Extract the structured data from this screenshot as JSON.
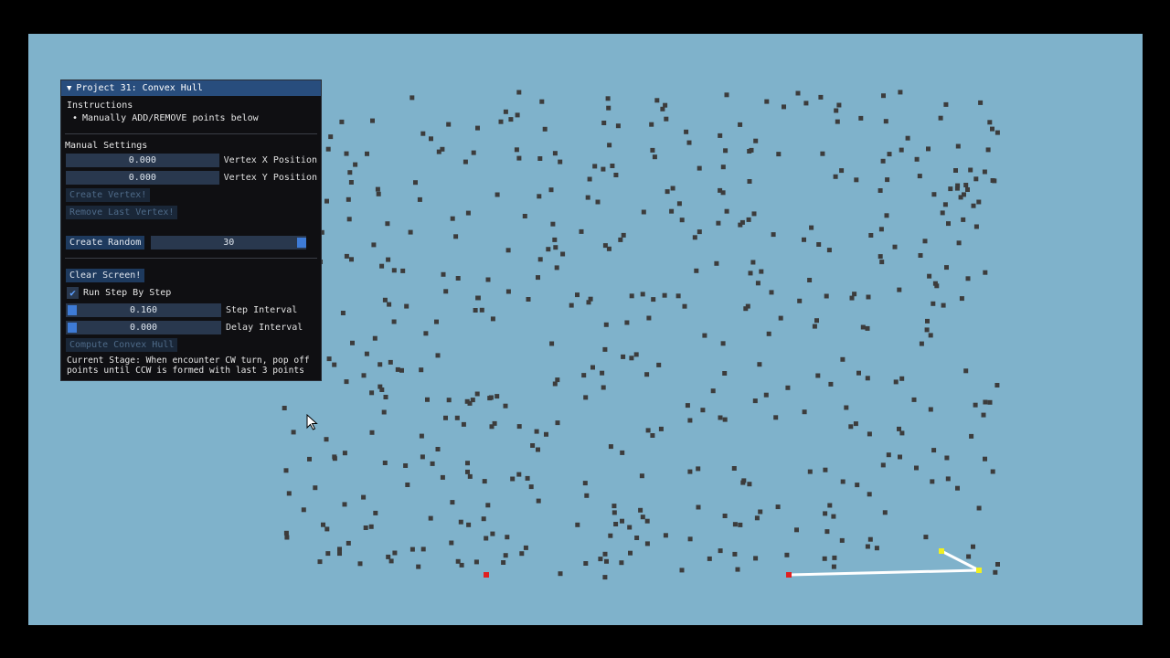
{
  "panel": {
    "title": "Project 31: Convex Hull",
    "instructions_heading": "Instructions",
    "instruction_bullet": "Manually ADD/REMOVE points below",
    "manual_heading": "Manual Settings",
    "vertex_x": {
      "value": "0.000",
      "label": "Vertex X Position"
    },
    "vertex_y": {
      "value": "0.000",
      "label": "Vertex Y Position"
    },
    "create_vertex_label": "Create Vertex!",
    "remove_vertex_label": "Remove Last Vertex!",
    "create_random_label": "Create Random",
    "random_count": "30",
    "clear_screen_label": "Clear Screen!",
    "step_checkbox_label": "Run Step By Step",
    "step_checked": true,
    "step_interval": {
      "value": "0.160",
      "label": "Step Interval"
    },
    "delay_interval": {
      "value": "0.000",
      "label": "Delay Interval"
    },
    "compute_label": "Compute Convex Hull",
    "current_stage": "Current Stage: When encounter CW turn, pop off points until CCW is formed with last 3 points"
  },
  "colors": {
    "background": "#7fb2cb",
    "point": "#3c3c3c",
    "hull_line": "#ffffff",
    "active_line": "#ffffff",
    "highlight_red": "#e02020",
    "highlight_yellow": "#f0f020"
  }
}
